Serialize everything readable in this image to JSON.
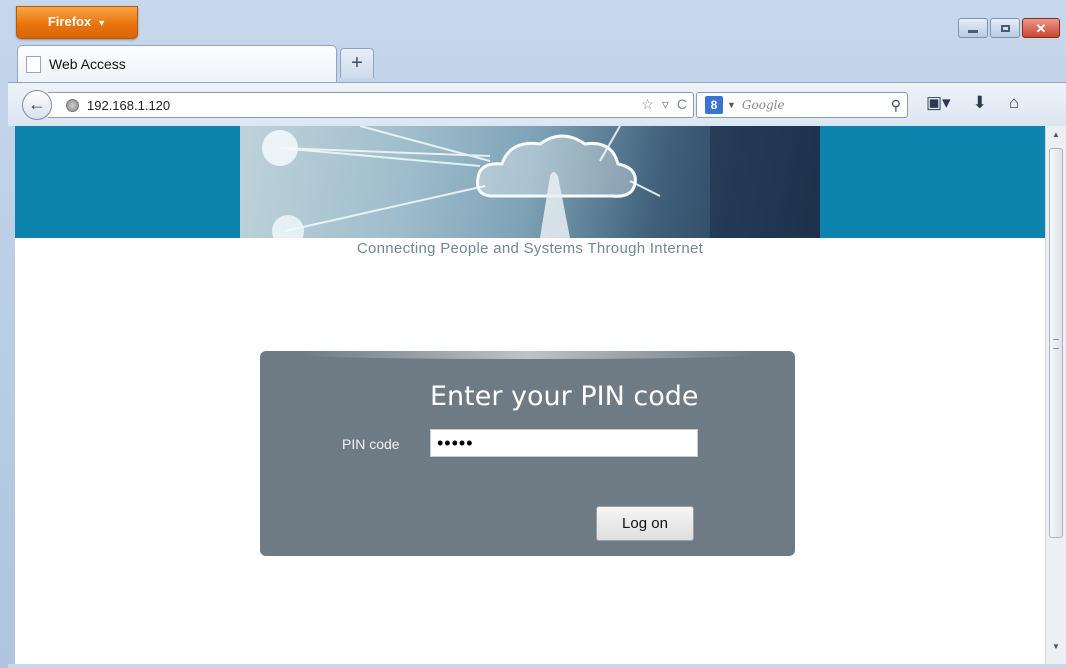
{
  "browser": {
    "menu_button": "Firefox",
    "tab_title": "Web Access",
    "new_tab_label": "+",
    "url": "192.168.1.120",
    "search_placeholder": "Google",
    "search_engine_glyph": "8"
  },
  "page": {
    "tagline": "Connecting People and Systems Through Internet",
    "login": {
      "title": "Enter your PIN code",
      "pin_label": "PIN code",
      "pin_value": "12345",
      "button_label": "Log on"
    }
  },
  "colors": {
    "banner": "#0d84ad",
    "panel": "#6e7a84",
    "firefox_orange": "#e8760d"
  }
}
